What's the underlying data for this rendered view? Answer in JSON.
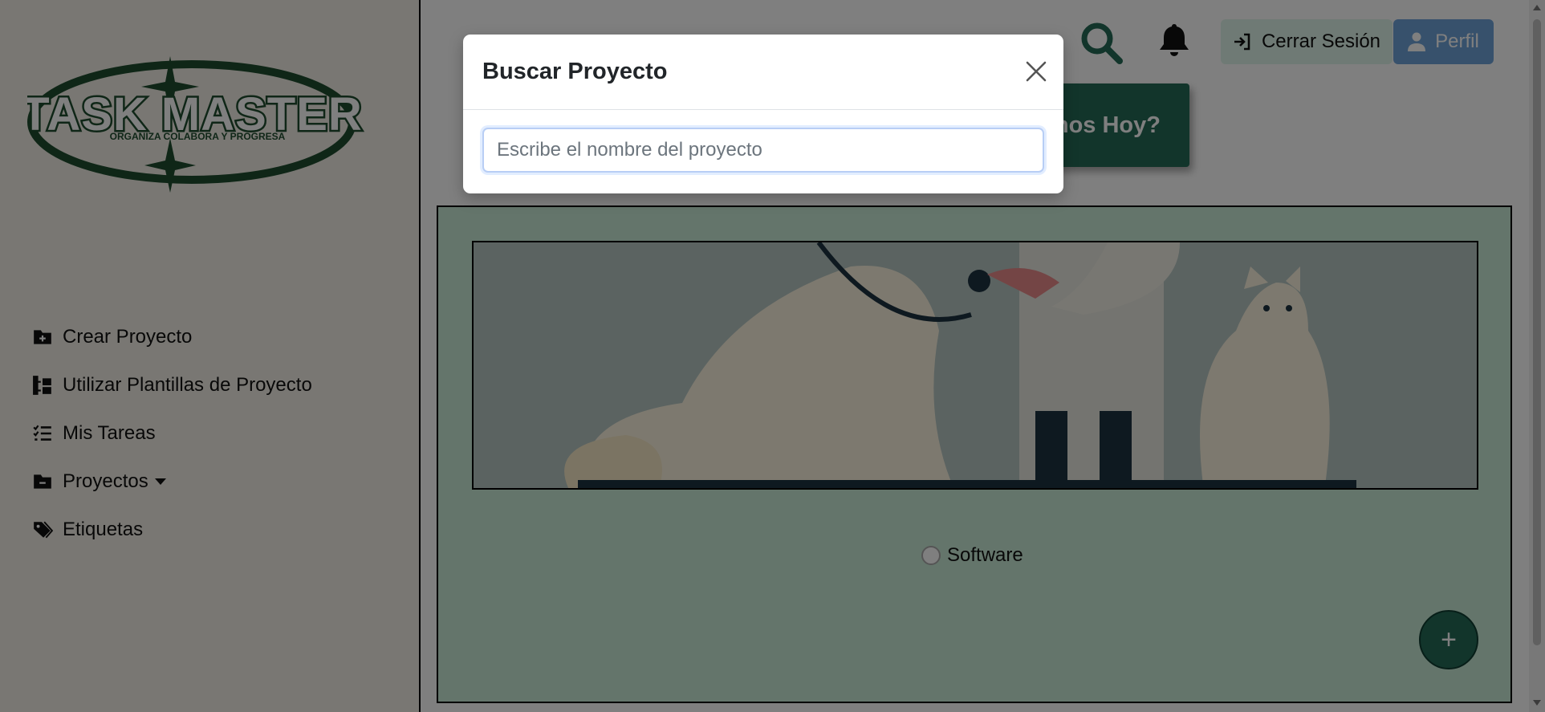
{
  "sidebar": {
    "logo": {
      "title": "TASK MASTER",
      "tagline": "ORGANIZA COLABORA Y PROGRESA"
    },
    "items": [
      {
        "label": "Crear Proyecto",
        "icon": "folder-plus-icon"
      },
      {
        "label": "Utilizar Plantillas de Proyecto",
        "icon": "folder-tree-icon"
      },
      {
        "label": "Mis Tareas",
        "icon": "list-check-icon"
      },
      {
        "label": "Proyectos",
        "icon": "folder-minus-icon",
        "dropdown": true
      },
      {
        "label": "Etiquetas",
        "icon": "tags-icon"
      }
    ]
  },
  "header": {
    "search_icon": "search-icon",
    "bell_icon": "bell-icon",
    "logout_label": "Cerrar Sesión",
    "profile_label": "Perfil"
  },
  "banner": {
    "partial_label": "nos Hoy?"
  },
  "main": {
    "project_image": "veterinarian-dog-cat-illustration",
    "radio_label": "Software",
    "fab_label": "+"
  },
  "modal": {
    "title": "Buscar Proyecto",
    "search_placeholder": "Escribe el nombre del proyecto",
    "search_value": ""
  },
  "colors": {
    "brand_green": "#246a57",
    "panel_bg": "#c9ebd7",
    "sidebar_bg": "#f2efe6",
    "profile_blue": "#6ea3d8",
    "logout_bg": "#dff5ea"
  }
}
